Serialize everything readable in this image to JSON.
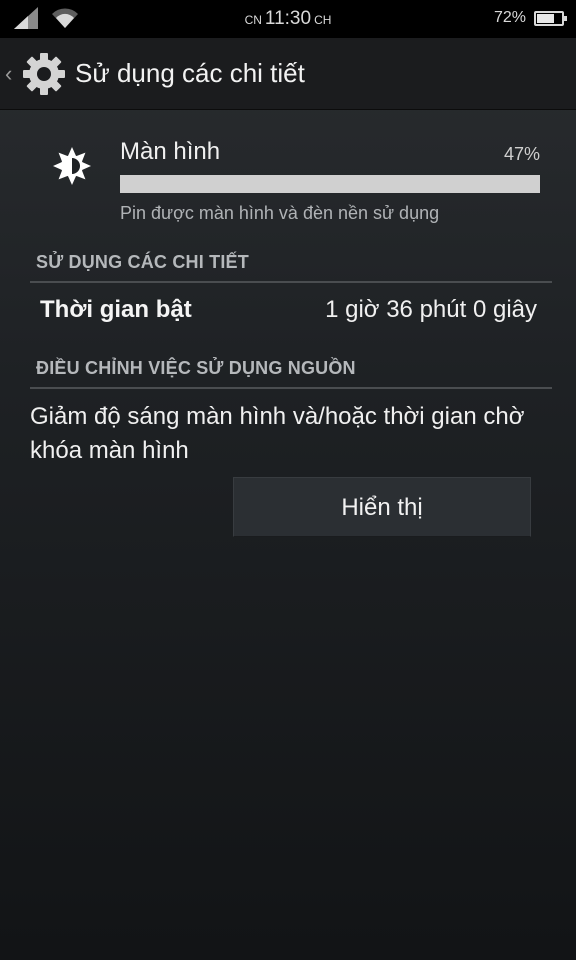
{
  "status_bar": {
    "time_prefix": "CN",
    "time": "11:30",
    "time_suffix": "CH",
    "battery_percent": "72%",
    "battery_level": 0.72
  },
  "action_bar": {
    "title": "Sử dụng các chi tiết",
    "icon": "gear-icon"
  },
  "usage": {
    "icon": "brightness-icon",
    "name": "Màn hình",
    "percent": "47%",
    "level": 1.0,
    "subtitle": "Pin được màn hình và đèn nền sử dụng"
  },
  "details_section": {
    "header": "SỬ DỤNG CÁC CHI TIẾT",
    "rows": [
      {
        "label": "Thời gian bật",
        "value": "1 giờ 36 phút 0 giây"
      }
    ]
  },
  "adjust_section": {
    "header": "ĐIỀU CHỈNH VIỆC SỬ DỤNG NGUỒN",
    "description": "Giảm độ sáng màn hình và/hoặc thời gian chờ khóa màn hình",
    "button_label": "Hiển thị"
  }
}
